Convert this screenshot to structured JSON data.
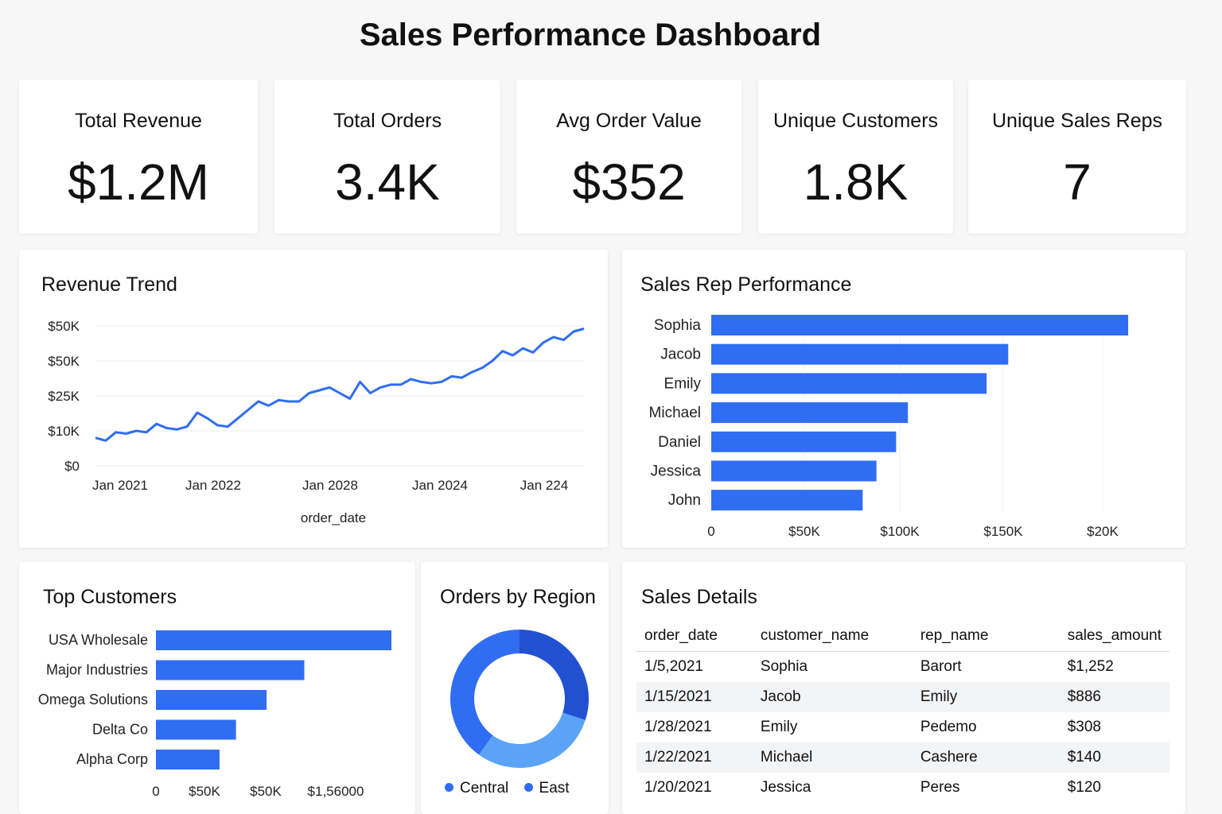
{
  "page": {
    "title": "Sales Performance Dashboard"
  },
  "kpis": [
    {
      "label": "Total Revenue",
      "value": "$1.2M"
    },
    {
      "label": "Total Orders",
      "value": "3.4K"
    },
    {
      "label": "Avg Order Value",
      "value": "$352"
    },
    {
      "label": "Unique Customers",
      "value": "1.8K"
    },
    {
      "label": "Unique Sales Reps",
      "value": "7"
    }
  ],
  "colors": {
    "bar": "#2f6df3",
    "line": "#2f6df3",
    "region_central": "#5ba3f6",
    "region_east": "#2151d1",
    "region_other": "#2f6df3"
  },
  "chart_data": [
    {
      "id": "revenue_trend",
      "type": "line",
      "title": "Revenue Trend",
      "xlabel": "order_date",
      "ylabel": "",
      "y_tick_labels": [
        "$0",
        "$10K",
        "$25K",
        "$50K",
        "$50K"
      ],
      "x_tick_labels": [
        "Jan 2021",
        "Jan 2022",
        "Jan 2028",
        "Jan 2024",
        "Jan 224"
      ],
      "grid": true,
      "series": [
        {
          "values": [
            10,
            9,
            12,
            11.5,
            12.5,
            12,
            15,
            13.5,
            13,
            14,
            19,
            17,
            14.5,
            14,
            17,
            20,
            23,
            21.5,
            23.5,
            23,
            23,
            26,
            27,
            28,
            26,
            24,
            30,
            26,
            28,
            29,
            29,
            31,
            30,
            29.5,
            30,
            32,
            31.5,
            33.5,
            35,
            37.5,
            41,
            39.5,
            42,
            40.5,
            44,
            46,
            45,
            48,
            49
          ]
        }
      ]
    },
    {
      "id": "sales_rep_performance",
      "type": "bar",
      "orientation": "horizontal",
      "title": "Sales Rep Performance",
      "categories": [
        "Sophia",
        "Jacob",
        "Emily",
        "Michael",
        "Daniel",
        "Jessica",
        "John"
      ],
      "values": [
        212000,
        151000,
        140000,
        100000,
        94000,
        84000,
        77000
      ],
      "x_tick_labels": [
        "0",
        "$50K",
        "$100K",
        "$150K",
        "$20K"
      ],
      "xlim": [
        0,
        250000
      ],
      "grid": true
    },
    {
      "id": "top_customers",
      "type": "bar",
      "orientation": "horizontal",
      "title": "Top Customers",
      "categories": [
        "USA Wholesale",
        "Major Industries",
        "Omega Solutions",
        "Delta Co",
        "Alpha Corp"
      ],
      "values": [
        100,
        63,
        47,
        34,
        27
      ],
      "x_tick_labels": [
        "0",
        "$50K",
        "$50K",
        "$1,56000"
      ],
      "grid": false
    },
    {
      "id": "orders_by_region",
      "type": "pie",
      "donut": true,
      "title": "Orders by Region",
      "slices": [
        {
          "name": "East",
          "value": 30
        },
        {
          "name": "Central",
          "value": 30
        },
        {
          "name": "",
          "value": 40
        }
      ],
      "legend": [
        "Central",
        "East"
      ],
      "legend_position": "bottom"
    }
  ],
  "sales_details": {
    "title": "Sales Details",
    "columns": [
      "order_date",
      "customer_name",
      "rep_name",
      "sales_amount"
    ],
    "rows": [
      [
        "1/5,2021",
        "Sophia",
        "Barort",
        "$1,252"
      ],
      [
        "1/15/2021",
        "Jacob",
        "Emily",
        "$886"
      ],
      [
        "1/28/2021",
        "Emily",
        "Pedemo",
        "$308"
      ],
      [
        "1/22/2021",
        "Michael",
        "Cashere",
        "$140"
      ],
      [
        "1/20/2021",
        "Jessica",
        "Peres",
        "$120"
      ]
    ]
  }
}
